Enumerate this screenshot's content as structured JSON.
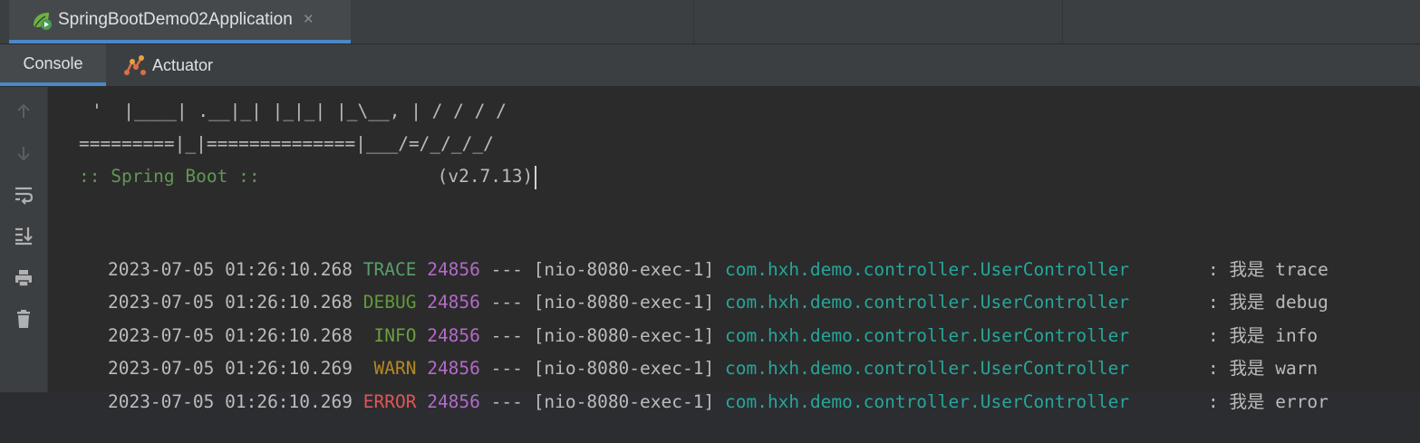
{
  "run_tab": {
    "title": "SpringBootDemo02Application",
    "close_glyph": "×",
    "icon": "spring-boot-run-icon"
  },
  "sub_tabs": [
    {
      "label": "Console",
      "active": true
    },
    {
      "label": "Actuator",
      "icon": "actuator-icon"
    }
  ],
  "toolbar": [
    {
      "name": "scroll-up-icon",
      "enabled": false
    },
    {
      "name": "scroll-down-icon",
      "enabled": false
    },
    {
      "name": "soft-wrap-icon",
      "enabled": true
    },
    {
      "name": "scroll-to-end-icon",
      "enabled": true
    },
    {
      "name": "print-icon",
      "enabled": true
    },
    {
      "name": "clear-all-icon",
      "enabled": true
    }
  ],
  "console": {
    "banner": [
      "'  |____| .__|_| |_|_| |_\\__, | / / / /",
      "=========|_|==============|___/=/_/_/_/",
      ":: Spring Boot ::",
      "(v2.7.13)"
    ],
    "logs": [
      {
        "timestamp": "2023-07-05 01:26:10.268",
        "level": "TRACE",
        "pid": "24856",
        "sep": "---",
        "thread": "[nio-8080-exec-1]",
        "logger": "com.hxh.demo.controller.UserController",
        "message": ": 我是 trace"
      },
      {
        "timestamp": "2023-07-05 01:26:10.268",
        "level": "DEBUG",
        "pid": "24856",
        "sep": "---",
        "thread": "[nio-8080-exec-1]",
        "logger": "com.hxh.demo.controller.UserController",
        "message": ": 我是 debug"
      },
      {
        "timestamp": "2023-07-05 01:26:10.268",
        "level": " INFO",
        "pid": "24856",
        "sep": "---",
        "thread": "[nio-8080-exec-1]",
        "logger": "com.hxh.demo.controller.UserController",
        "message": ": 我是 info"
      },
      {
        "timestamp": "2023-07-05 01:26:10.269",
        "level": " WARN",
        "pid": "24856",
        "sep": "---",
        "thread": "[nio-8080-exec-1]",
        "logger": "com.hxh.demo.controller.UserController",
        "message": ": 我是 warn"
      },
      {
        "timestamp": "2023-07-05 01:26:10.269",
        "level": "ERROR",
        "pid": "24856",
        "sep": "---",
        "thread": "[nio-8080-exec-1]",
        "logger": "com.hxh.demo.controller.UserController",
        "message": ": 我是 error"
      }
    ]
  },
  "colors": {
    "accent": "#4a88c7",
    "trace": "#5a9f6b",
    "debug": "#5f9a3a",
    "info": "#6a9f40",
    "warn": "#b38a24",
    "error": "#e05555",
    "pid": "#b36ac8",
    "logger": "#26a69a"
  }
}
